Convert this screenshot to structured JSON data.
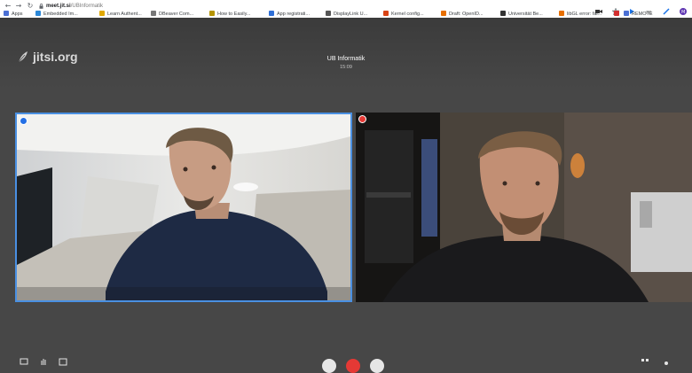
{
  "browser": {
    "url_host": "meet.jit.si",
    "url_path": "/UBInformatik",
    "bookmarks": [
      {
        "label": "Apps",
        "color": "#4a6fd4"
      },
      {
        "label": "Embedded Im...",
        "color": "#2b88d8"
      },
      {
        "label": "Learn Authent...",
        "color": "#e0a800"
      },
      {
        "label": "DBeaver Com...",
        "color": "#777777"
      },
      {
        "label": "How to Easily...",
        "color": "#b59400"
      },
      {
        "label": "App registrati...",
        "color": "#2f6fd6"
      },
      {
        "label": "DisplayLink U...",
        "color": "#555555"
      },
      {
        "label": "Kernel config...",
        "color": "#d84315"
      },
      {
        "label": "Draft: OpenID...",
        "color": "#e76f00"
      },
      {
        "label": "Universität Be...",
        "color": "#333333"
      },
      {
        "label": "libGL error: fai...",
        "color": "#e76f00"
      },
      {
        "label": "",
        "color": "#d32f2f"
      },
      {
        "label": "REMOTE",
        "color": "#4a6fd4"
      }
    ]
  },
  "meeting": {
    "logo_text": "jitsi.org",
    "room_name": "UB Informatik",
    "elapsed": "15:09",
    "colors": {
      "active_border": "#4a90e2",
      "hangup": "#e53935",
      "background": "#474747"
    }
  },
  "tiles": [
    {
      "name": "local-participant",
      "badge": "dominant-speaker",
      "active": true
    },
    {
      "name": "remote-participant",
      "badge": "muted",
      "active": false
    }
  ],
  "toolbar": {
    "left_icons": [
      "chat-icon",
      "raise-hand-icon",
      "participants-icon"
    ],
    "center_buttons": [
      "microphone-button",
      "hangup-button",
      "camera-button"
    ],
    "right_icons": [
      "tile-view-icon",
      "more-icon"
    ]
  }
}
